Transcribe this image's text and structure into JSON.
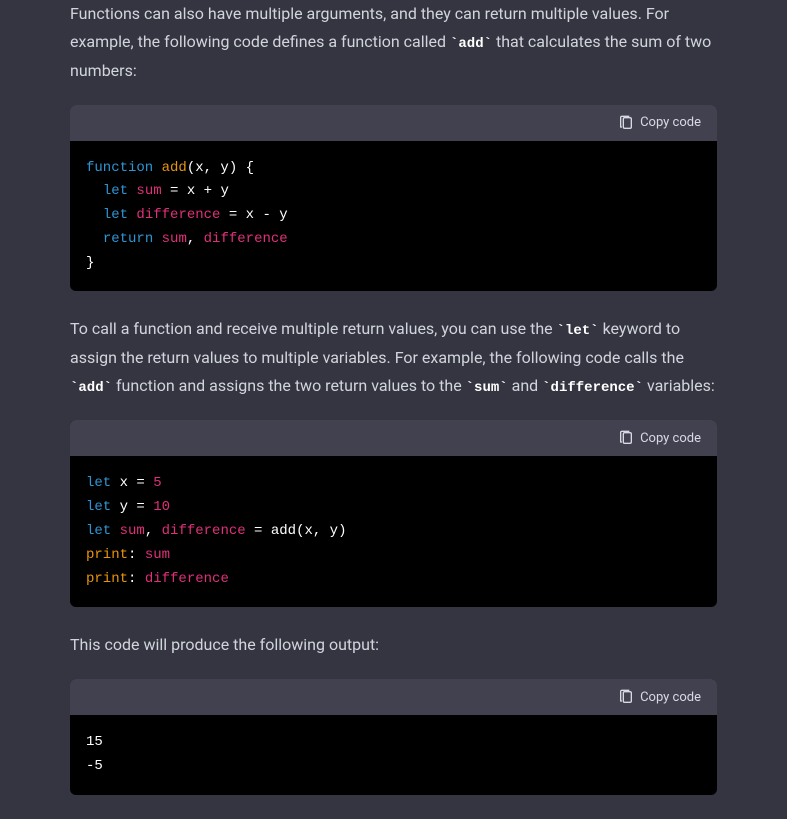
{
  "paragraphs": {
    "p1_a": "Functions can also have multiple arguments, and they can return multiple values. For example, the following code defines a function called ",
    "p1_code1": "`add`",
    "p1_b": " that calculates the sum of two numbers:",
    "p2_a": "To call a function and receive multiple return values, you can use the ",
    "p2_code1": "`let`",
    "p2_b": " keyword to assign the return values to multiple variables. For example, the following code calls the ",
    "p2_code2": "`add`",
    "p2_c": " function and assigns the two return values to the ",
    "p2_code3": "`sum`",
    "p2_d": " and ",
    "p2_code4": "`difference`",
    "p2_e": " variables:",
    "p3": "This code will produce the following output:"
  },
  "copy_label": "Copy code",
  "code1": {
    "l1_function": "function",
    "l1_name": " add",
    "l1_rest": "(x, y) {",
    "l2_let": "let",
    "l2_var": " sum",
    "l2_rest": " = x + y",
    "l3_let": "let",
    "l3_var": " difference",
    "l3_rest": " = x - y",
    "l4_return": "return",
    "l4_var1": " sum",
    "l4_comma": ", ",
    "l4_var2": "difference",
    "l5": "}"
  },
  "code2": {
    "l1_let": "let",
    "l1_rest": " x = ",
    "l1_num": "5",
    "l2_let": "let",
    "l2_rest": " y = ",
    "l2_num": "10",
    "l3_let": "let",
    "l3_var1": " sum",
    "l3_comma": ", ",
    "l3_var2": "difference",
    "l3_rest": " = add(x, y)",
    "l4_print": "print",
    "l4_colon": ": ",
    "l4_var": "sum",
    "l5_print": "print",
    "l5_colon": ": ",
    "l5_var": "difference"
  },
  "code3": {
    "l1": "15",
    "l2": "-5"
  }
}
